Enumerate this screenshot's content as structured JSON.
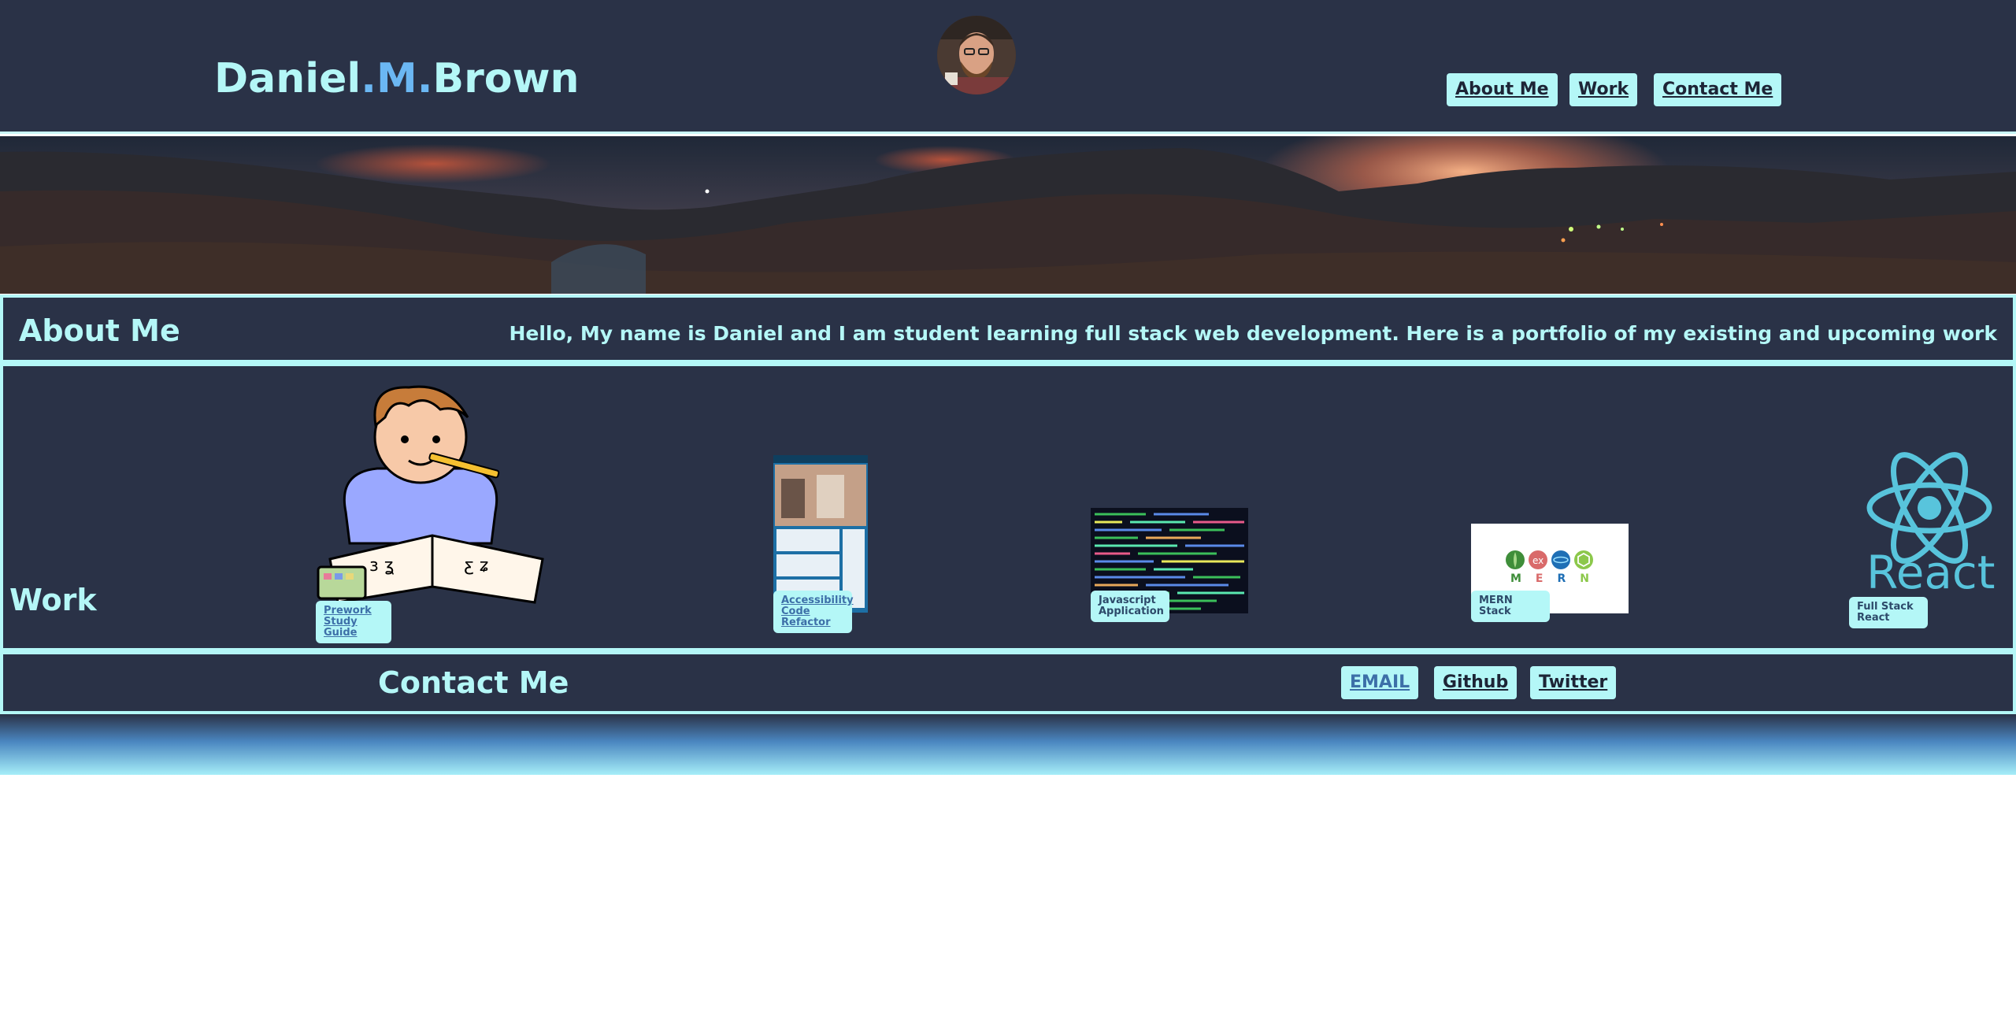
{
  "header": {
    "logo_first": "Daniel",
    "logo_dot1": ".",
    "logo_mid": "M",
    "logo_dot2": ".",
    "logo_last": "Brown",
    "nav": {
      "about": "About Me",
      "work": "Work",
      "contact": "Contact Me"
    }
  },
  "about": {
    "heading": "About Me",
    "text": "Hello, My name is Daniel and I am student learning full stack web development. Here is a portfolio of my existing and upcoming work"
  },
  "work": {
    "heading": "Work",
    "projects": [
      {
        "label": "Prework Study Guide"
      },
      {
        "label": "Accessibility Code Refactor"
      },
      {
        "label": "Javascript Application"
      },
      {
        "label": "MERN Stack"
      },
      {
        "label": "Full Stack React"
      }
    ],
    "mern_letters": [
      "M",
      "E",
      "R",
      "N"
    ],
    "react_word": "React"
  },
  "contact": {
    "heading": "Contact Me",
    "links": {
      "email": "EMAIL",
      "github": "Github",
      "twitter": "Twitter"
    }
  },
  "colors": {
    "background": "#2a3247",
    "accent": "#b4f7f7",
    "logo_mid": "#6bb7f3"
  }
}
